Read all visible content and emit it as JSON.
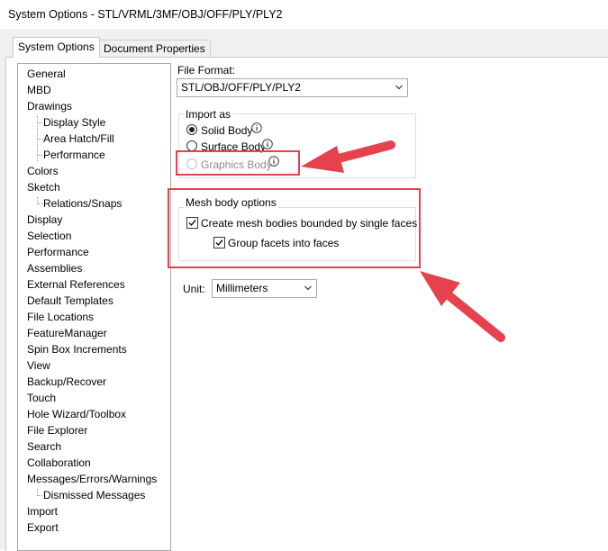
{
  "window": {
    "title": "System Options - STL/VRML/3MF/OBJ/OFF/PLY/PLY2"
  },
  "tabs": [
    {
      "label": "System Options",
      "active": true
    },
    {
      "label": "Document Properties",
      "active": false
    }
  ],
  "tree": {
    "items": [
      {
        "label": "General"
      },
      {
        "label": "MBD"
      },
      {
        "label": "Drawings"
      },
      {
        "label": "Display Style"
      },
      {
        "label": "Area Hatch/Fill"
      },
      {
        "label": "Performance"
      },
      {
        "label": "Colors"
      },
      {
        "label": "Sketch"
      },
      {
        "label": "Relations/Snaps"
      },
      {
        "label": "Display"
      },
      {
        "label": "Selection"
      },
      {
        "label": "Performance"
      },
      {
        "label": "Assemblies"
      },
      {
        "label": "External References"
      },
      {
        "label": "Default Templates"
      },
      {
        "label": "File Locations"
      },
      {
        "label": "FeatureManager"
      },
      {
        "label": "Spin Box Increments"
      },
      {
        "label": "View"
      },
      {
        "label": "Backup/Recover"
      },
      {
        "label": "Touch"
      },
      {
        "label": "Hole Wizard/Toolbox"
      },
      {
        "label": "File Explorer"
      },
      {
        "label": "Search"
      },
      {
        "label": "Collaboration"
      },
      {
        "label": "Messages/Errors/Warnings"
      },
      {
        "label": "Dismissed Messages"
      },
      {
        "label": "Import"
      },
      {
        "label": "Export"
      }
    ]
  },
  "file_format": {
    "label": "File Format:",
    "value": "STL/OBJ/OFF/PLY/PLY2"
  },
  "import_as": {
    "title": "Import as",
    "options": [
      {
        "label": "Solid Body",
        "checked": true,
        "enabled": true,
        "icon": "info-icon"
      },
      {
        "label": "Surface Body",
        "checked": false,
        "enabled": true,
        "icon": "info-icon"
      },
      {
        "label": "Graphics Body",
        "checked": false,
        "enabled": false,
        "icon": "info-icon"
      }
    ]
  },
  "mesh_options": {
    "title": "Mesh body options",
    "create_mesh": {
      "label": "Create mesh bodies bounded by single faces",
      "checked": true
    },
    "group_facets": {
      "label": "Group facets into faces",
      "checked": true
    }
  },
  "unit": {
    "label": "Unit:",
    "value": "Millimeters"
  },
  "colors": {
    "highlight": "#e5424e",
    "accent": "#e5424e"
  }
}
